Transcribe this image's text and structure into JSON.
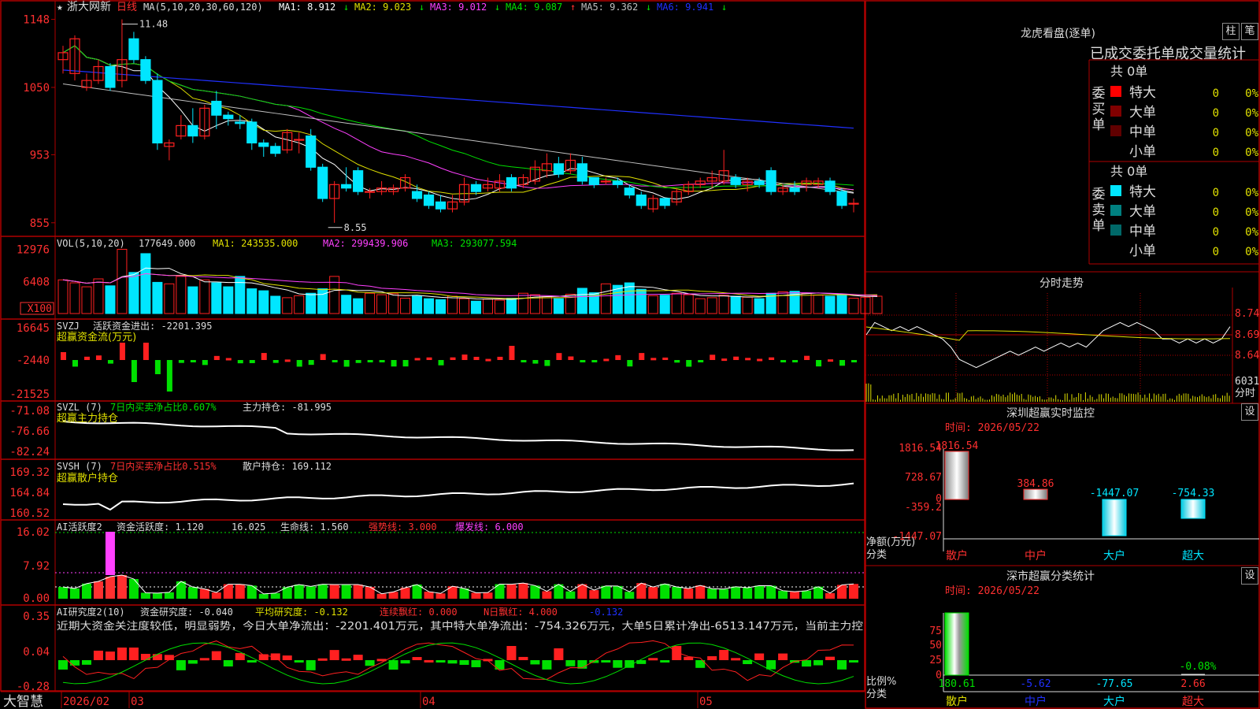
{
  "brand": "大智慧",
  "stock": {
    "name": "浙大网新",
    "period": "日线",
    "mark": "★"
  },
  "colors": {
    "up": "#ff2020",
    "down": "#00e6ff",
    "grid": "#b00000",
    "ma1": "#ffffff",
    "ma2": "#e0e000",
    "ma3": "#ff40ff",
    "ma4": "#00e000",
    "ma5": "#c0c0c0",
    "ma6": "#2030ff"
  },
  "panels": {
    "main": {
      "params": "MA(5,10,20,30,60,120)",
      "mas": [
        {
          "label": "MA1: 8.912",
          "arrow": "↓",
          "color": "#ffffff"
        },
        {
          "label": "MA2: 9.023",
          "arrow": "↓",
          "color": "#e0e000"
        },
        {
          "label": "MA3: 9.012",
          "arrow": "↓",
          "color": "#ff40ff"
        },
        {
          "label": "MA4: 9.087",
          "arrow": "↑",
          "color": "#00e000"
        },
        {
          "label": "MA5: 9.362",
          "arrow": "↓",
          "color": "#c0c0c0"
        },
        {
          "label": "MA6: 9.941",
          "arrow": "↓",
          "color": "#2030ff"
        }
      ],
      "yticks": [
        "1148",
        "1050",
        "953",
        "855"
      ],
      "high_label": "11.48",
      "low_label": "8.55"
    },
    "vol": {
      "title": "VOL(5,10,20)",
      "value": "177649.000",
      "ma1": "MA1: 243535.000",
      "ma2": "MA2: 299439.906",
      "ma3": "MA3: 293077.594",
      "yticks": [
        "12976",
        "6408",
        "X100"
      ]
    },
    "svzj": {
      "title": "SVZJ",
      "label": "活跃资金进出: -2201.395",
      "sub": "超赢资金流(万元)",
      "yticks": [
        "16645",
        "-2440",
        "-21525"
      ]
    },
    "svzl": {
      "title": "SVZL (7)",
      "ratio": "7日内买卖净占比0.607%",
      "pos": "主力持仓: -81.995",
      "sub": "超赢主力持仓",
      "yticks": [
        "-71.08",
        "-76.66",
        "-82.24"
      ]
    },
    "svsh": {
      "title": "SVSH (7)",
      "ratio": "7日内买卖净占比0.515%",
      "pos": "散户持仓: 169.112",
      "sub": "超赢散户持仓",
      "yticks": [
        "169.32",
        "164.84",
        "160.52"
      ]
    },
    "ai1": {
      "title": "AI活跃度2",
      "a": "资金活跃度: 1.120",
      "b": "16.025",
      "c": "生命线: 1.560",
      "d": "强势线: 3.000",
      "e": "爆发线: 6.000",
      "yticks": [
        "16.02",
        "7.92",
        "0.00"
      ]
    },
    "ai2": {
      "title": "AI研究度2(10)",
      "a": "资金研究度: -0.040",
      "b": "平均研究度: -0.132",
      "c": "连续飘红: 0.000",
      "d": "N日飘红: 4.000",
      "e": "-0.132",
      "note": "近期大资金关注度较低，明显弱势，今日大单净流出：-2201.401万元，其中特大单净流出：-754.326万元，大单5日累计净出-6513.147万元，当前主力控",
      "yticks": [
        "0.35",
        "0.04",
        "-0.28"
      ]
    }
  },
  "xaxis": {
    "labels": [
      "2026/02",
      "03",
      "04",
      "05"
    ]
  },
  "sidebar": {
    "lhb": {
      "title": "龙虎看盘(逐单)",
      "btn1": "柱",
      "btn2": "笔",
      "header": "已成交委托单成交量统计",
      "buy_label": "委买单",
      "sell_label": "委卖单",
      "buy_total": "共 0单",
      "sell_total": "共 0单",
      "buy_rows": [
        {
          "name": "特大",
          "count": "0",
          "pct": "0%",
          "color": "#ff0000"
        },
        {
          "name": "大单",
          "count": "0",
          "pct": "0%",
          "color": "#800000"
        },
        {
          "name": "中单",
          "count": "0",
          "pct": "0%",
          "color": "#600000"
        },
        {
          "name": "小单",
          "count": "0",
          "pct": "0%",
          "color": ""
        }
      ],
      "sell_rows": [
        {
          "name": "特大",
          "count": "0",
          "pct": "0%",
          "color": "#00e6ff"
        },
        {
          "name": "大单",
          "count": "0",
          "pct": "0%",
          "color": "#008080"
        },
        {
          "name": "中单",
          "count": "0",
          "pct": "0%",
          "color": "#006868"
        },
        {
          "name": "小单",
          "count": "0",
          "pct": "0%",
          "color": ""
        }
      ]
    },
    "intraday": {
      "title": "分时走势",
      "yticks": [
        "8.74",
        "8.69",
        "8.64"
      ],
      "vol": "6031",
      "vol_unit": "分时"
    },
    "sz_monitor": {
      "title": "深圳超赢实时监控",
      "btn": "设",
      "time": "时间: 2026/05/22",
      "yticks": [
        "1816.54",
        "728.67",
        "0",
        "-359.2",
        "-1447.07"
      ],
      "ylabel": "净额(万元)",
      "xlabel": "分类",
      "cats": [
        "散户",
        "中户",
        "大户",
        "超大"
      ],
      "values": [
        1816.54,
        384.86,
        -1447.07,
        -754.33
      ],
      "value_labels": [
        "1816.54",
        "384.86",
        "-1447.07",
        "-754.33"
      ]
    },
    "sz_stats": {
      "title": "深市超赢分类统计",
      "btn": "设",
      "time": "时间: 2026/05/22",
      "yticks": [
        "75",
        "50",
        "25",
        "0"
      ],
      "ylabel": "比例%",
      "xlabel": "分类",
      "cats": [
        "散户",
        "中户",
        "大户",
        "超大"
      ],
      "values": [
        180.61,
        -5.62,
        -77.65,
        2.66
      ],
      "value_labels": [
        "180.61",
        "-5.62",
        "-77.65",
        "2.66"
      ],
      "note": "-0.08%"
    }
  },
  "chart_data": [
    {
      "type": "candlestick",
      "title": "浙大网新 日线",
      "x": [
        "2026/02",
        "03",
        "04",
        "05"
      ],
      "ylim": [
        8.4,
        11.6
      ],
      "candles": [
        [
          10.9,
          11.0,
          10.7,
          11.1
        ],
        [
          10.7,
          11.2,
          10.6,
          11.25
        ],
        [
          10.5,
          10.6,
          10.45,
          10.7
        ],
        [
          10.6,
          10.8,
          10.55,
          10.9
        ],
        [
          10.8,
          10.5,
          10.45,
          10.85
        ],
        [
          10.6,
          10.9,
          10.5,
          11.48
        ],
        [
          11.2,
          10.9,
          10.85,
          11.3
        ],
        [
          10.9,
          10.6,
          10.55,
          10.95
        ],
        [
          10.6,
          9.7,
          9.6,
          10.7
        ],
        [
          9.65,
          9.7,
          9.45,
          9.75
        ],
        [
          9.8,
          9.95,
          9.75,
          10.1
        ],
        [
          9.95,
          9.8,
          9.7,
          10.2
        ],
        [
          9.8,
          10.2,
          9.75,
          10.25
        ],
        [
          10.3,
          10.1,
          9.9,
          10.45
        ],
        [
          10.1,
          10.05,
          9.95,
          10.15
        ],
        [
          10.0,
          9.98,
          9.9,
          10.1
        ],
        [
          10.0,
          9.7,
          9.6,
          10.05
        ],
        [
          9.7,
          9.65,
          9.5,
          9.75
        ],
        [
          9.65,
          9.55,
          9.5,
          9.7
        ],
        [
          9.6,
          9.85,
          9.55,
          9.9
        ],
        [
          9.75,
          9.75,
          9.55,
          9.85
        ],
        [
          9.8,
          9.35,
          9.3,
          9.9
        ],
        [
          9.35,
          8.9,
          8.85,
          9.4
        ],
        [
          8.9,
          9.1,
          8.55,
          9.15
        ],
        [
          9.1,
          9.05,
          9.0,
          9.35
        ],
        [
          9.3,
          9.0,
          8.95,
          9.35
        ],
        [
          9.0,
          9.0,
          8.9,
          9.05
        ],
        [
          9.0,
          9.05,
          8.95,
          9.15
        ],
        [
          9.0,
          9.05,
          8.95,
          9.1
        ],
        [
          9.05,
          9.2,
          9.0,
          9.25
        ],
        [
          9.0,
          8.9,
          8.85,
          9.1
        ],
        [
          8.95,
          8.8,
          8.75,
          9.0
        ],
        [
          8.85,
          8.75,
          8.7,
          8.95
        ],
        [
          8.75,
          8.85,
          8.7,
          8.95
        ],
        [
          8.85,
          9.1,
          8.8,
          9.2
        ],
        [
          9.1,
          9.0,
          8.95,
          9.15
        ],
        [
          9.05,
          9.1,
          9.0,
          9.2
        ],
        [
          9.05,
          9.15,
          9.0,
          9.25
        ],
        [
          9.2,
          9.05,
          9.0,
          9.25
        ],
        [
          9.1,
          9.2,
          9.05,
          9.25
        ],
        [
          9.15,
          9.35,
          9.1,
          9.45
        ],
        [
          9.3,
          9.4,
          9.2,
          9.55
        ],
        [
          9.4,
          9.25,
          9.2,
          9.5
        ],
        [
          9.3,
          9.45,
          9.25,
          9.55
        ],
        [
          9.4,
          9.15,
          9.1,
          9.5
        ],
        [
          9.2,
          9.1,
          9.05,
          9.2
        ],
        [
          9.15,
          9.15,
          9.1,
          9.2
        ],
        [
          9.15,
          9.1,
          9.05,
          9.2
        ],
        [
          9.05,
          8.95,
          8.9,
          9.1
        ],
        [
          8.95,
          8.8,
          8.75,
          9.0
        ],
        [
          8.75,
          8.9,
          8.7,
          8.95
        ],
        [
          8.9,
          8.8,
          8.75,
          8.9
        ],
        [
          8.85,
          9.0,
          8.8,
          9.05
        ],
        [
          9.0,
          9.1,
          8.95,
          9.15
        ],
        [
          9.1,
          9.15,
          9.05,
          9.2
        ],
        [
          9.15,
          9.2,
          9.05,
          9.3
        ],
        [
          9.15,
          9.3,
          9.1,
          9.6
        ],
        [
          9.2,
          9.1,
          9.05,
          9.25
        ],
        [
          9.1,
          9.15,
          9.0,
          9.2
        ],
        [
          9.15,
          9.1,
          9.05,
          9.2
        ],
        [
          9.3,
          9.0,
          8.95,
          9.35
        ],
        [
          9.0,
          9.05,
          8.95,
          9.1
        ],
        [
          9.05,
          9.0,
          8.95,
          9.15
        ],
        [
          9.1,
          9.15,
          9.0,
          9.2
        ],
        [
          9.1,
          9.15,
          9.05,
          9.2
        ],
        [
          9.15,
          9.0,
          8.95,
          9.2
        ],
        [
          9.0,
          8.8,
          8.75,
          9.05
        ],
        [
          8.82,
          8.83,
          8.7,
          8.9
        ]
      ]
    },
    {
      "type": "bar",
      "title": "VOL(5,10,20)",
      "ylim": [
        0,
        14000
      ],
      "values": [
        6800,
        6200,
        5400,
        7000,
        5600,
        12976,
        8300,
        12100,
        6300,
        6000,
        7500,
        5400,
        6800,
        6200,
        5400,
        7500,
        5000,
        4600,
        3500,
        3200,
        3600,
        4100,
        5000,
        7500,
        3700,
        3000,
        4100,
        3800,
        4000,
        3100,
        3500,
        3000,
        2800,
        3500,
        3000,
        2500,
        2900,
        2700,
        3100,
        4100,
        3800,
        3400,
        3000,
        3900,
        5100,
        4200,
        6000,
        5700,
        6200,
        4900,
        3600,
        3700,
        4100,
        3800,
        3000,
        3200,
        3700,
        3500,
        3300,
        3000,
        4100,
        4400,
        4500,
        4100,
        3700,
        3500,
        3800,
        3100,
        3300,
        3500
      ]
    }
  ]
}
